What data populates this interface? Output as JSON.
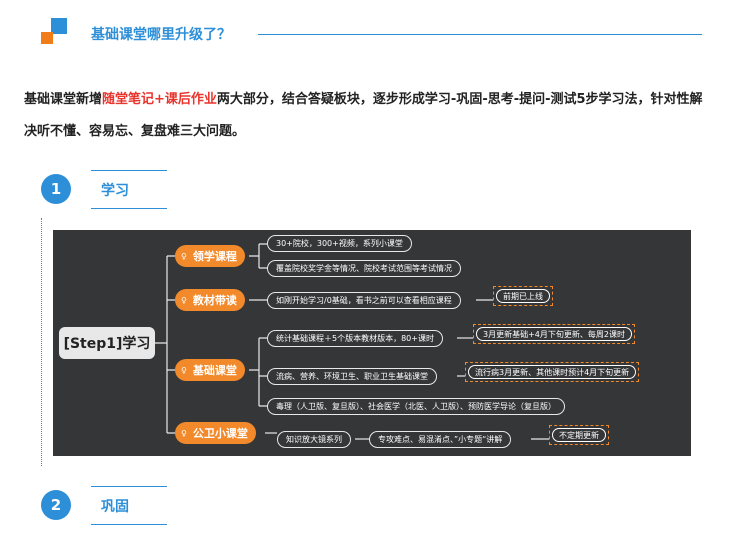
{
  "header": {
    "title": "基础课堂哪里升级了？"
  },
  "intro": {
    "part1": "基础课堂新增",
    "highlight": "随堂笔记+课后作业",
    "part2": "两大部分，结合答疑板块，逐步形成学习-巩固-思考-提问-测试5步学习法，针对性解决听不懂、容易忘、复盘难三大问题。"
  },
  "steps": [
    {
      "number": "1",
      "label": "学习"
    },
    {
      "number": "2",
      "label": "巩固"
    }
  ],
  "mindmap": {
    "root": "[Step1]学习",
    "branches": [
      {
        "label": "领学课程",
        "leaves": [
          "30+院校，300+视频，系列小课堂",
          "覆盖院校奖学金等情况、院校考试范围等考试情况"
        ]
      },
      {
        "label": "教材带读",
        "leaves": [
          "如刚开始学习/0基础，看书之前可以查看相应课程"
        ],
        "tag": "前期已上线"
      },
      {
        "label": "基础课堂",
        "leaves": [
          "统计基础课程＋5个版本教材版本，80+课时",
          "流病、营养、环境卫生、职业卫生基础课堂",
          "毒理（人卫版、复旦版）、社会医学（北医、人卫版）、预防医学导论（复旦版）"
        ],
        "tags": [
          "3月更新基础+4月下旬更新、每周2课时",
          "流行病3月更新、其他课时预计4月下旬更新"
        ]
      },
      {
        "label": "公卫小课堂",
        "leaves": [
          "知识放大镜系列",
          "专攻难点、易混淆点、”小专题“讲解"
        ],
        "tag": "不定期更新"
      }
    ]
  },
  "colors": {
    "accent_blue": "#2d8fd8",
    "accent_orange": "#f2892a",
    "highlight_red": "#e8342c",
    "mindmap_bg": "#353638"
  }
}
